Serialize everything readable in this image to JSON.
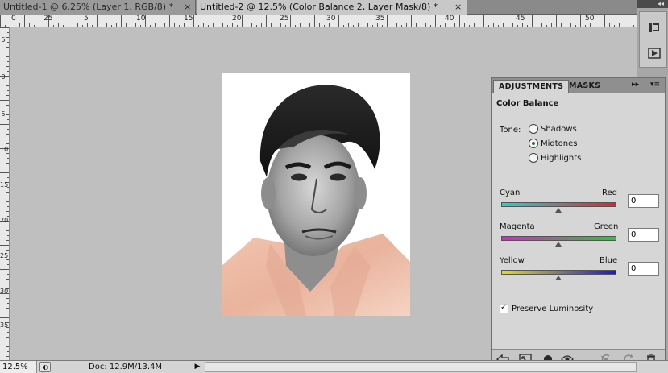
{
  "tabs": [
    {
      "label": "Untitled-1 @ 6.25% (Layer 1, RGB/8) *",
      "close": "×"
    },
    {
      "label": "Untitled-2 @ 12.5% (Color Balance 2, Layer Mask/8) *",
      "close": "×"
    }
  ],
  "ruler": {
    "top_labels": [
      "0",
      "25",
      "5",
      "10",
      "15",
      "20",
      "25",
      "30",
      "35",
      "40",
      "45",
      "50"
    ],
    "left_labels": [
      "5",
      "0",
      "5",
      "10",
      "15",
      "20",
      "25",
      "30",
      "35",
      "40"
    ]
  },
  "right_strip": {
    "collapse": "◂◂",
    "icons": [
      "history-icon",
      "actions-icon"
    ]
  },
  "panel": {
    "tab_active": "ADJUSTMENTS",
    "tab_inactive": "MASKS",
    "menu_collapse": "▸▸",
    "menu_options": "▾≡",
    "title": "Color Balance",
    "tone_label": "Tone:",
    "tones": [
      {
        "label": "Shadows",
        "selected": false
      },
      {
        "label": "Midtones",
        "selected": true
      },
      {
        "label": "Highlights",
        "selected": false
      }
    ],
    "sliders": [
      {
        "left": "Cyan",
        "right": "Red",
        "value": "0",
        "from": "#24d1d1",
        "to": "#e0242b"
      },
      {
        "left": "Magenta",
        "right": "Green",
        "value": "0",
        "from": "#e020d6",
        "to": "#1fcf2a"
      },
      {
        "left": "Yellow",
        "right": "Blue",
        "value": "0",
        "from": "#e4dc18",
        "to": "#1a18d8"
      }
    ],
    "preserve_label": "Preserve Luminosity",
    "preserve_checked": true,
    "footer_icons": [
      "return-arrow-icon",
      "expand-view-icon",
      "clip-layer-icon",
      "visibility-eye-icon",
      "previous-state-icon",
      "reset-icon",
      "trash-icon"
    ]
  },
  "status": {
    "zoom": "12.5%",
    "doc": "Doc: 12.9M/13.4M",
    "arrow": "▶"
  }
}
